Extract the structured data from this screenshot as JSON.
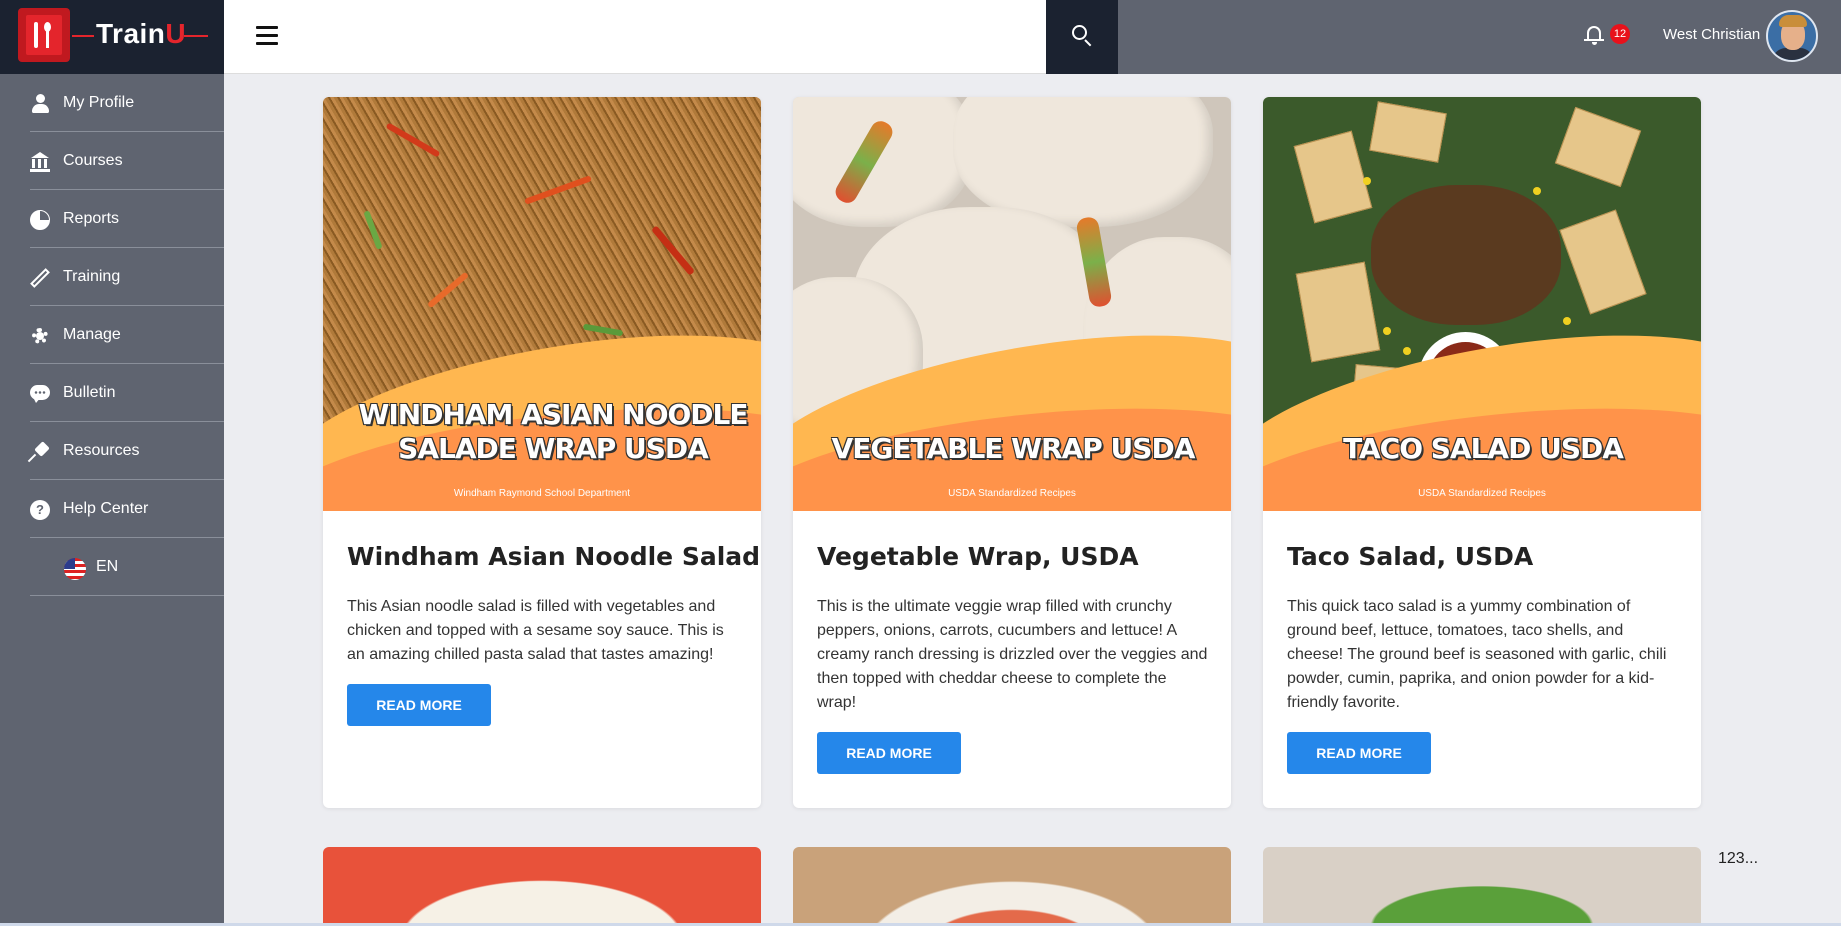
{
  "app": {
    "logo_text": "Train",
    "logo_accent": "U"
  },
  "header": {
    "notification_count": "12",
    "user_name": "West Christian"
  },
  "sidebar": {
    "items": [
      {
        "label": "My Profile",
        "icon": "user-icon"
      },
      {
        "label": "Courses",
        "icon": "bank-icon"
      },
      {
        "label": "Reports",
        "icon": "pie-chart-icon"
      },
      {
        "label": "Training",
        "icon": "pencil-icon"
      },
      {
        "label": "Manage",
        "icon": "gear-icon"
      },
      {
        "label": "Bulletin",
        "icon": "chat-icon"
      },
      {
        "label": "Resources",
        "icon": "pin-icon"
      },
      {
        "label": "Help Center",
        "icon": "help-icon"
      }
    ],
    "language": "EN"
  },
  "cards": [
    {
      "image_title": "WINDHAM ASIAN NOODLE SALADE WRAP USDA",
      "image_subtitle": "Windham Raymond School Department",
      "title": "Windham Asian Noodle Salad",
      "text": "This Asian noodle salad is filled with vegetables and chicken and topped with a sesame soy sauce. This is an amazing chilled pasta salad that tastes amazing!",
      "button": "READ MORE"
    },
    {
      "image_title": "VEGETABLE WRAP USDA",
      "image_subtitle": "USDA Standardized Recipes",
      "title": "Vegetable Wrap, USDA",
      "text": "This is the ultimate veggie wrap filled with crunchy peppers, onions, carrots, cucumbers and lettuce! A creamy ranch dressing is drizzled over the veggies and then topped with cheddar cheese to complete the wrap!",
      "button": "READ MORE"
    },
    {
      "image_title": "TACO SALAD USDA",
      "image_subtitle": "USDA Standardized Recipes",
      "title": "Taco Salad, USDA",
      "text": "This quick taco salad is a yummy combination of ground beef, lettuce, tomatoes, taco shells, and cheese! The ground beef is seasoned with garlic, chili powder, cumin, paprika, and onion powder for a kid-friendly favorite.",
      "button": "READ MORE"
    }
  ],
  "pagination": "123...",
  "colors": {
    "sidebar_bg": "#5f6470",
    "logo_bg": "#1b2230",
    "brand_red": "#e4252c",
    "button_blue": "#2587ea",
    "banner_orange": "#ff934a",
    "banner_yellow": "#ffb750"
  }
}
